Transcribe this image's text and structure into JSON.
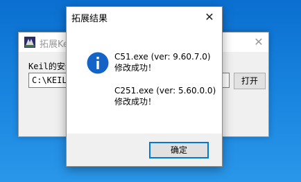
{
  "background_window": {
    "title": "拓展Keil",
    "label": "Keil的安装",
    "path_value": "C:\\KEIL_V",
    "open_button": "打开",
    "close_glyph": "✕"
  },
  "dialog": {
    "title": "拓展结果",
    "close_glyph": "✕",
    "icon": "info-icon",
    "messages": {
      "line1": "C51.exe (ver: 9.60.7.0)",
      "line2": "修改成功！",
      "line3": "C251.exe (ver: 5.60.0.0)",
      "line4": "修改成功！"
    },
    "ok_button": "确定"
  },
  "colors": {
    "accent": "#0078d7",
    "info_icon": "#1464c8",
    "desktop": "#1a86e0"
  }
}
